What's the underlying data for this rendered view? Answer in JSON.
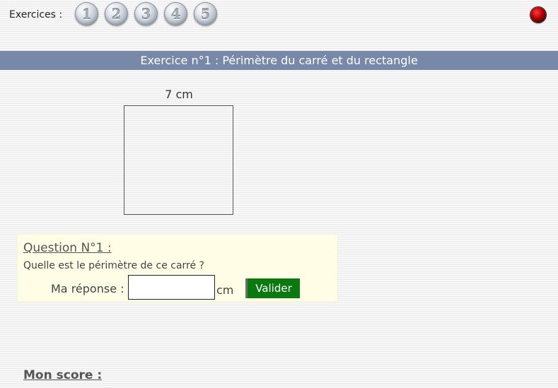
{
  "header": {
    "exercises_label": "Exercices :",
    "exercise_buttons": [
      "1",
      "2",
      "3",
      "4",
      "5"
    ]
  },
  "title": "Exercice n°1 : Périmètre du carré et du rectangle",
  "figure": {
    "side_label": "7 cm",
    "shape": "square"
  },
  "question": {
    "title": "Question N°1 :",
    "text": "Quelle est le périmètre de ce carré ?",
    "answer_label": "Ma réponse :",
    "answer_value": "",
    "unit": "cm",
    "validate_label": "Valider"
  },
  "score": {
    "label": "Mon score :"
  },
  "colors": {
    "title_bar": "#7788a8",
    "question_bg": "#fffde6",
    "validate_bg": "#0a7a10",
    "quit_button": "#b00000"
  },
  "icons": {
    "quit": "red-button-icon"
  }
}
